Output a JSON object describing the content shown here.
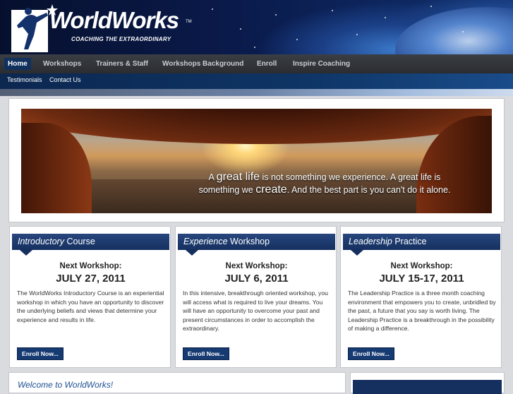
{
  "brand": {
    "name": "WorldWorks",
    "trademark": "TM",
    "tagline": "COACHING THE EXTRAORDINARY"
  },
  "nav_primary": [
    {
      "label": "Home",
      "active": true
    },
    {
      "label": "Workshops"
    },
    {
      "label": "Trainers & Staff"
    },
    {
      "label": "Workshops Background"
    },
    {
      "label": "Enroll"
    },
    {
      "label": "Inspire Coaching"
    }
  ],
  "nav_secondary": [
    {
      "label": "Testimonials"
    },
    {
      "label": "Contact Us"
    }
  ],
  "banner": {
    "quote_a": "A ",
    "quote_b": "great life",
    "quote_c": " is not something we experience. A great life is",
    "quote_d": "something we ",
    "quote_e": "create",
    "quote_f": ". And the best part is you can't do it alone."
  },
  "cards": [
    {
      "title_em": "Introductory",
      "title_rest": " Course",
      "next_label": "Next Workshop:",
      "date": "JULY 27, 2011",
      "body": "The WorldWorks Introductory Course is an experiential workshop in which you have an opportunity to discover the underlying beliefs and views that determine your experience and results in life.",
      "button": "Enroll Now..."
    },
    {
      "title_em": "Experience",
      "title_rest": " Workshop",
      "next_label": "Next Workshop:",
      "date": "JULY 6, 2011",
      "body": "In this intensive, breakthrough oriented workshop, you will access what is required to live your dreams. You will have an opportunity to overcome your past and present circumstances in order to accomplish the extraordinary.",
      "button": "Enroll Now..."
    },
    {
      "title_em": "Leadership",
      "title_rest": " Practice",
      "next_label": "Next Workshop:",
      "date": "JULY 15-17, 2011",
      "body": "The Leadership Practice is a three month coaching environment that empowers you to create, unbridled by the past, a future that you say is worth living. The Leadership Practice is a breakthrough in the possibility of making a difference.",
      "button": "Enroll Now..."
    }
  ],
  "welcome": {
    "title": "Welcome to WorldWorks!"
  },
  "colors": {
    "nav_active": "#10305e",
    "card_header": "#15305f",
    "link_blue": "#1f4f92"
  }
}
